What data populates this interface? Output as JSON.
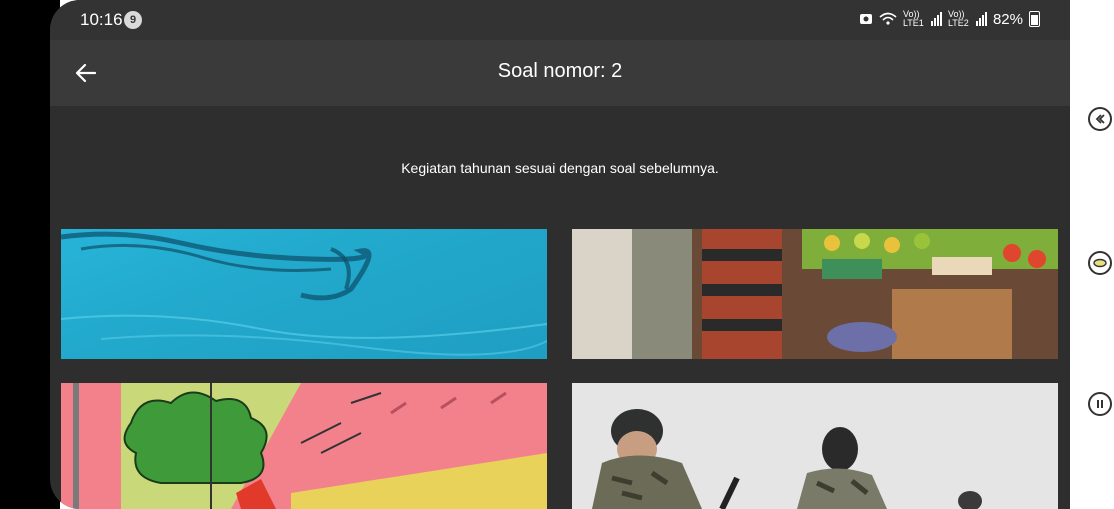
{
  "status_bar": {
    "time": "10:16",
    "notification_count": "9",
    "lte1": "Vo)) LTE1",
    "lte2": "Vo)) LTE2",
    "battery": "82%"
  },
  "app_bar": {
    "title": "Soal nomor: 2",
    "back_icon": "arrow-left-icon"
  },
  "question": {
    "text": "Kegiatan tahunan sesuai dengan soal sebelumnya."
  },
  "options": [
    {
      "name": "option-image-1",
      "subject": "blue water surface"
    },
    {
      "name": "option-image-2",
      "subject": "market stall with produce"
    },
    {
      "name": "option-image-3",
      "subject": "pink roof with trees illustration"
    },
    {
      "name": "option-image-4",
      "subject": "soldiers in camouflage"
    }
  ],
  "side_controls": [
    "back-chevron-icon",
    "oval-icon",
    "pause-icon"
  ]
}
